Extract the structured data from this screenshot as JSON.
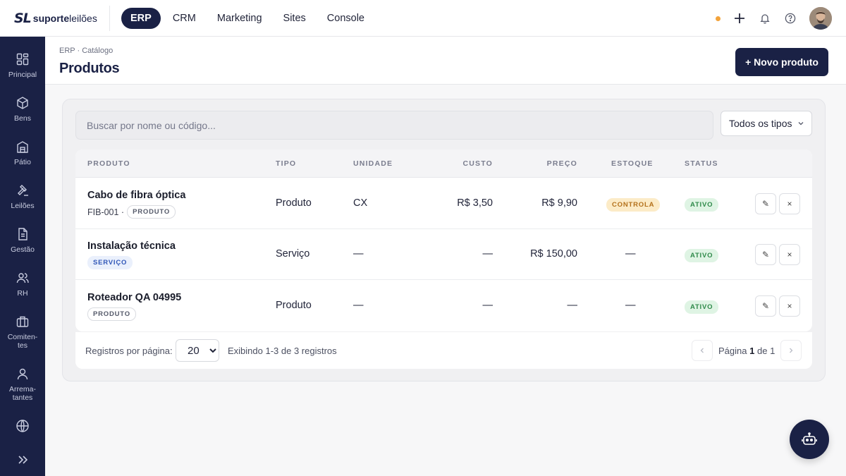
{
  "brand": {
    "mark": "SL",
    "name_bold": "suporte",
    "name_regular": "leilões"
  },
  "topnav": [
    {
      "label": "ERP",
      "active": true
    },
    {
      "label": "CRM",
      "active": false
    },
    {
      "label": "Marketing",
      "active": false
    },
    {
      "label": "Sites",
      "active": false
    },
    {
      "label": "Console",
      "active": false
    }
  ],
  "top_actions": {
    "status_color": "#f3a33a",
    "icons": [
      "plus-icon",
      "bell-icon",
      "help-icon"
    ]
  },
  "sidebar": {
    "items": [
      {
        "label": "Principal",
        "icon": "grid-icon"
      },
      {
        "label": "Bens",
        "icon": "box-icon"
      },
      {
        "label": "Pátio",
        "icon": "warehouse-icon"
      },
      {
        "label": "Leilões",
        "icon": "gavel-icon"
      },
      {
        "label": "Gestão",
        "icon": "document-icon"
      },
      {
        "label": "RH",
        "icon": "users-icon"
      },
      {
        "label": "Comiten-\ntes",
        "icon": "briefcase-icon"
      },
      {
        "label": "Arrema-\ntantes",
        "icon": "user-icon"
      },
      {
        "label": "",
        "icon": "globe-icon"
      }
    ],
    "expand_icon": "chevrons-right-icon"
  },
  "header": {
    "breadcrumb": "ERP · Catálogo",
    "title": "Produtos",
    "new_button": "+ Novo produto"
  },
  "filters": {
    "search_placeholder": "Buscar por nome ou código...",
    "type_select": "Todos os tipos"
  },
  "table": {
    "columns": [
      "PRODUTO",
      "TIPO",
      "UNIDADE",
      "CUSTO",
      "PREÇO",
      "ESTOQUE",
      "STATUS"
    ],
    "rows": [
      {
        "name": "Cabo de fibra óptica",
        "code": "FIB-001 ·",
        "chip": "PRODUTO",
        "tipo": "Produto",
        "unidade": "CX",
        "custo": "R$ 3,50",
        "preco": "R$ 9,90",
        "estoque": "CONTROLA",
        "status": "ATIVO"
      },
      {
        "name": "Instalação técnica",
        "code": "",
        "chip": "SERVIÇO",
        "tipo": "Serviço",
        "unidade": "—",
        "custo": "—",
        "preco": "R$ 150,00",
        "estoque": "—",
        "status": "ATIVO"
      },
      {
        "name": "Roteador QA 04995",
        "code": "",
        "chip": "PRODUTO",
        "tipo": "Produto",
        "unidade": "—",
        "custo": "—",
        "preco": "—",
        "estoque": "—",
        "status": "ATIVO"
      }
    ],
    "edit_glyph": "✎",
    "delete_glyph": "×"
  },
  "pagination": {
    "per_page_label": "Registros por página:",
    "per_page_value": "20",
    "info": "Exibindo 1-3 de 3 registros",
    "page_prefix": "Página",
    "page_current": "1",
    "page_mid": "de",
    "page_total": "1"
  },
  "fab": {
    "icon": "robot-icon"
  }
}
